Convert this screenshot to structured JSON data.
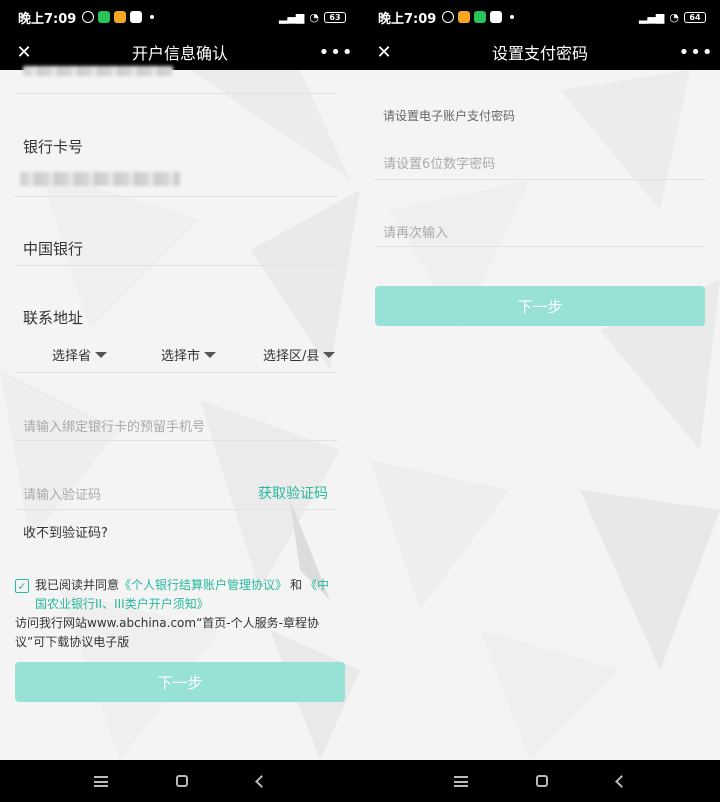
{
  "left": {
    "status": {
      "time": "晚上7:09",
      "battery": "63"
    },
    "title": "开户信息确认",
    "bank_card_label": "银行卡号",
    "bank_name": "中国银行",
    "address_label": "联系地址",
    "province": "选择省",
    "city": "选择市",
    "district": "选择区/县",
    "phone_placeholder": "请输入绑定银行卡的预留手机号",
    "code_placeholder": "请输入验证码",
    "get_code": "获取验证码",
    "no_code": "收不到验证码?",
    "agree_prefix": "我已阅读并同意",
    "agreement1": "《个人银行结算账户管理协议》",
    "agree_and": "和",
    "agreement2": "《中国农业银行II、III类户开户须知》",
    "note": "访问我行网站www.abchina.com“首页-个人服务-章程协议”可下载协议电子版",
    "next": "下一步"
  },
  "right": {
    "status": {
      "time": "晚上7:09",
      "battery": "64"
    },
    "title": "设置支付密码",
    "section_label": "请设置电子账户支付密码",
    "pwd_placeholder": "请设置6位数字密码",
    "pwd2_placeholder": "请再次输入",
    "next": "下一步"
  },
  "icons": {
    "close": "close-icon",
    "more": "more-icon",
    "dropdown": "caret-down-icon",
    "checkbox": "checkbox-checked-icon"
  },
  "colors": {
    "accent": "#28b89e",
    "button": "#97e1d6",
    "bar": "#000000"
  }
}
